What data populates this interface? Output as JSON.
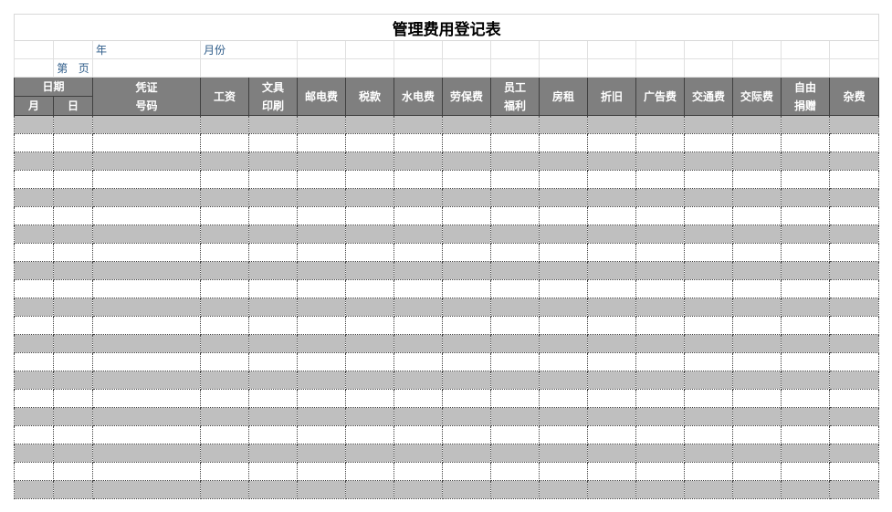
{
  "title": "管理费用登记表",
  "info": {
    "year_label": "年",
    "month_label": "月份",
    "page_label": "第   页"
  },
  "headers": {
    "date": "日期",
    "month": "月",
    "day": "日",
    "voucher_line1": "凭证",
    "voucher_line2": "号码",
    "salary": "工资",
    "stationery_line1": "文具",
    "stationery_line2": "印刷",
    "postal": "邮电费",
    "tax": "税款",
    "utilities": "水电费",
    "labor_insurance": "劳保费",
    "welfare_line1": "员工",
    "welfare_line2": "福利",
    "rent": "房租",
    "depreciation": "折旧",
    "advertising": "广告费",
    "transport": "交通费",
    "entertainment": "交际费",
    "donation_line1": "自由",
    "donation_line2": "捐赠",
    "misc": "杂费"
  },
  "body_rows": 21
}
